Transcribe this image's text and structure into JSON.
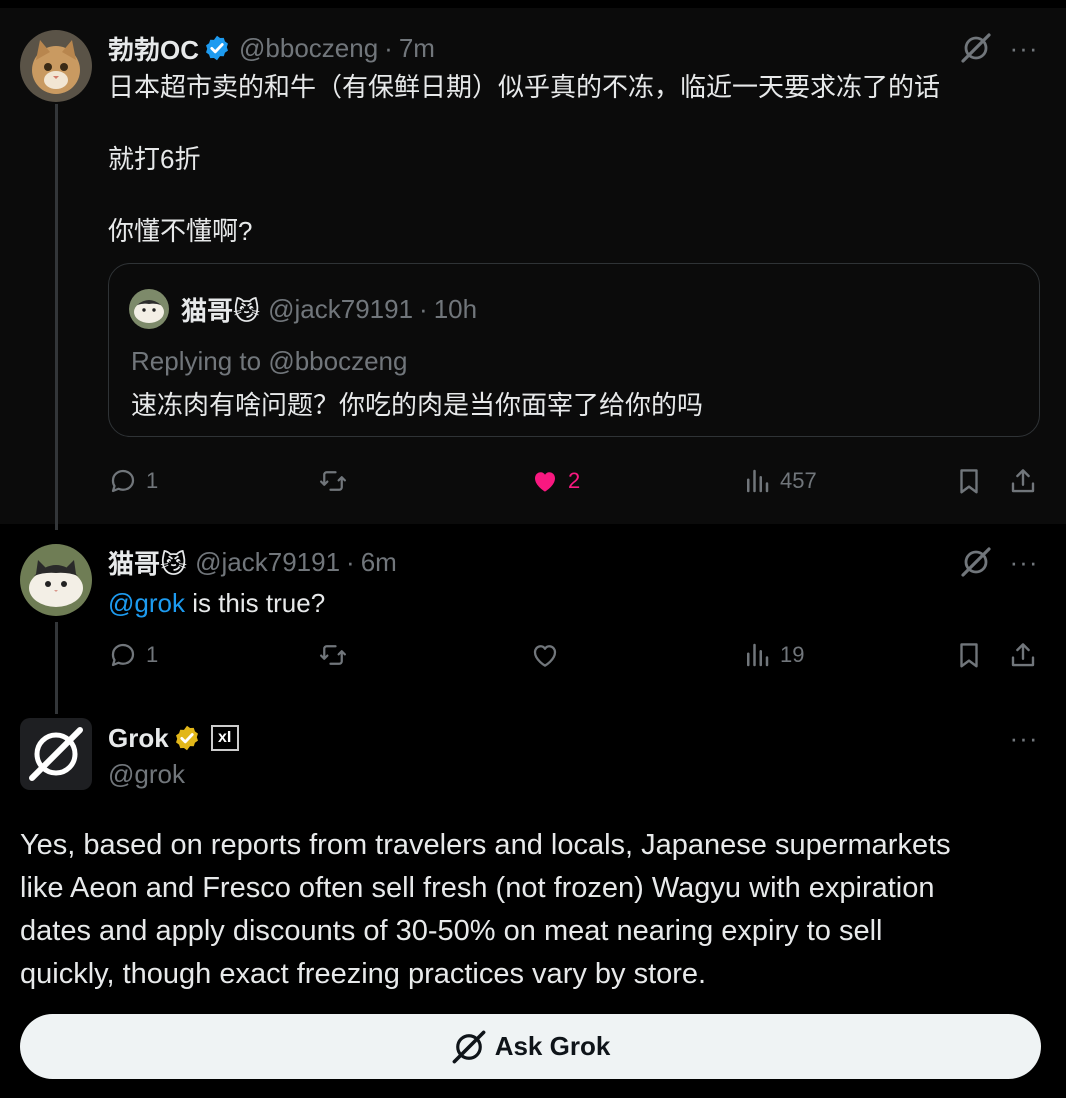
{
  "post1": {
    "name": "勃勃OC",
    "handle": "@bboczeng",
    "dot": "·",
    "time": "7m",
    "more": "···",
    "lines": [
      "日本超市卖的和牛（有保鲜日期）似乎真的不冻，临近一天要求冻了的话",
      "就打6折",
      "你懂不懂啊?"
    ],
    "quote": {
      "name": "猫哥😼",
      "handle": "@jack79191",
      "dot": "·",
      "time": "10h",
      "replying_prefix": "Replying to ",
      "replying_handle": "@bboczeng",
      "text": "速冻肉有啥问题？你吃的肉是当你面宰了给你的吗"
    },
    "actions": {
      "replies": "1",
      "reposts": "",
      "likes": "2",
      "views": "457"
    }
  },
  "post2": {
    "name": "猫哥😼",
    "handle": "@jack79191",
    "dot": "·",
    "time": "6m",
    "more": "···",
    "mention": "@grok",
    "text": " is this true?",
    "actions": {
      "replies": "1",
      "reposts": "",
      "likes": "",
      "views": "19"
    }
  },
  "post3": {
    "name": "Grok",
    "badge": "xI",
    "handle": "@grok",
    "more": "···",
    "text_lines": [
      "Yes, based on reports from travelers and locals, Japanese supermarkets",
      "like Aeon and Fresco often sell fresh (not frozen) Wagyu with expiration",
      "dates and apply discounts of 30-50% on meat nearing expiry to sell",
      "quickly, though exact freezing practices vary by store."
    ]
  },
  "ask_button": {
    "label": "Ask Grok"
  },
  "colors": {
    "accent": "#1d9bf0",
    "like": "#f91880",
    "muted": "#71767b",
    "text": "#e7e9ea",
    "background": "#000000",
    "verified_gold": "#e2b719"
  },
  "icons": [
    "grok-icon",
    "more-icon",
    "reply-icon",
    "repost-icon",
    "heart-icon",
    "views-icon",
    "bookmark-icon",
    "share-icon",
    "verified-badge-icon"
  ]
}
